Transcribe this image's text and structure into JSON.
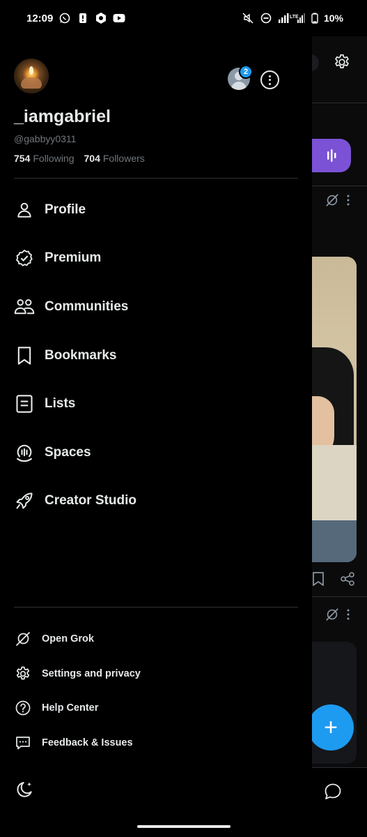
{
  "status_bar": {
    "time": "12:09",
    "battery": "10%",
    "left_icons": [
      "whatsapp-icon",
      "sim-icon",
      "app-icon",
      "youtube-icon"
    ],
    "right_icons": [
      "mute-icon",
      "dnd-icon",
      "signal-icon",
      "lte-icon",
      "battery-icon"
    ]
  },
  "profile": {
    "display_name": "_iamgabriel",
    "handle": "@gabbyy0311",
    "following_count": "754",
    "following_label": "Following",
    "followers_count": "704",
    "followers_label": "Followers",
    "account_badge": "2"
  },
  "menu": {
    "items": [
      {
        "label": "Profile",
        "icon": "person-icon"
      },
      {
        "label": "Premium",
        "icon": "verified-badge-icon"
      },
      {
        "label": "Communities",
        "icon": "communities-icon"
      },
      {
        "label": "Bookmarks",
        "icon": "bookmark-icon"
      },
      {
        "label": "Lists",
        "icon": "list-icon"
      },
      {
        "label": "Spaces",
        "icon": "spaces-icon"
      },
      {
        "label": "Creator Studio",
        "icon": "rocket-icon"
      }
    ]
  },
  "secondary_menu": {
    "items": [
      {
        "label": "Open Grok",
        "icon": "grok-icon"
      },
      {
        "label": "Settings and privacy",
        "icon": "gear-icon"
      },
      {
        "label": "Help Center",
        "icon": "help-icon"
      },
      {
        "label": "Feedback & Issues",
        "icon": "feedback-icon"
      }
    ]
  },
  "colors": {
    "background": "#000000",
    "text": "#e7e9ea",
    "muted": "#71767b",
    "accent": "#1d9bf0",
    "spaces_purple": "#7b52d6"
  }
}
